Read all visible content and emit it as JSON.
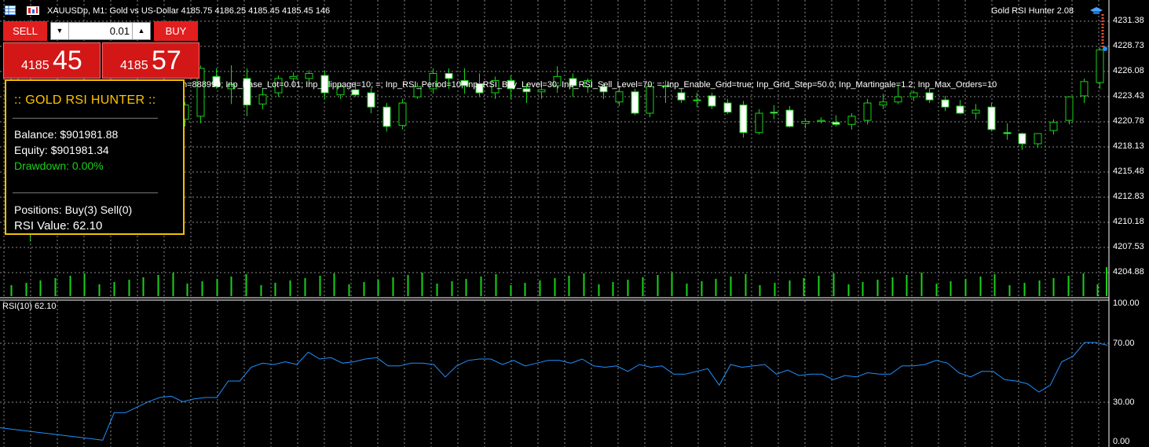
{
  "header": {
    "symbol_line": "XAUUSDp, M1:  Gold vs US-Dollar  4185.75 4186.25 4185.45 4185.45  146",
    "ea_name": "Gold RSI Hunter 2.08",
    "inputs_line": "n=888999; Inp_Base_Lot=0.01; Inp_Slippage=10; =; Inp_RSI_Period=10; Inp_RSI_Buy_Level=30; Inp_RSI_Sell_Level=70; =; Inp_Enable_Grid=true; Inp_Grid_Step=50.0; Inp_Martingale=1.2; Inp_Max_Orders=10"
  },
  "trade_panel": {
    "sell_label": "SELL",
    "buy_label": "BUY",
    "lot_value": "0.01",
    "sell_price_small": "4185",
    "sell_price_big": "45",
    "buy_price_small": "4185",
    "buy_price_big": "57"
  },
  "info_panel": {
    "title": ":: GOLD RSI HUNTER ::",
    "balance": "Balance:  $901981.88",
    "equity": "Equity:   $901981.34",
    "drawdown": "Drawdown: 0.00%",
    "positions": "Positions: Buy(3) Sell(0)",
    "rsi_value": "RSI Value: 62.10"
  },
  "price_axis": [
    "4231.38",
    "4228.73",
    "4226.08",
    "4223.43",
    "4220.78",
    "4218.13",
    "4215.48",
    "4212.83",
    "4210.18",
    "4207.53",
    "4204.88"
  ],
  "rsi_axis": [
    "100.00",
    "70.00",
    "30.00",
    "0.00"
  ],
  "rsi_label": "RSI(10) 62.10",
  "colors": {
    "background": "#000000",
    "grid": "#8a8a8a",
    "bull_candle": "#000000",
    "bear_candle": "#ffffff",
    "candle_outline": "#19d219",
    "volume": "#19d219",
    "rsi_line": "#1e90ff",
    "panel_border": "#f2c200",
    "sell_buy": "#e21f1f"
  },
  "chart_data": {
    "type": "candlestick",
    "price_range": [
      4203.5,
      4232.7
    ],
    "candles": [
      [
        4224.0,
        4226.3,
        4223.2,
        4225.6
      ],
      [
        4219.0,
        4221.3,
        4209.0,
        4219.0
      ],
      [
        4218.3,
        4220.0,
        4214.8,
        4215.4
      ],
      [
        4215.3,
        4216.3,
        4214.2,
        4214.9
      ],
      [
        4214.9,
        4216.0,
        4214.6,
        4215.5
      ],
      [
        4215.3,
        4215.8,
        4214.9,
        4215.5
      ],
      [
        4215.5,
        4217.5,
        4215.0,
        4217.2
      ],
      [
        4217.4,
        4220.8,
        4217.0,
        4220.6
      ],
      [
        4220.7,
        4222.2,
        4220.1,
        4222.0
      ],
      [
        4221.8,
        4222.5,
        4220.5,
        4221.6
      ],
      [
        4221.5,
        4222.3,
        4220.4,
        4222.0
      ],
      [
        4221.0,
        4222.7,
        4220.3,
        4222.4
      ],
      [
        4221.3,
        4226.3,
        4220.6,
        4226.0
      ],
      [
        4225.2,
        4226.0,
        4224.0,
        4224.2
      ],
      [
        4224.0,
        4226.3,
        4222.5,
        4224.4
      ],
      [
        4225.0,
        4226.0,
        4221.3,
        4222.4
      ],
      [
        4222.5,
        4224.0,
        4222.0,
        4223.4
      ],
      [
        4223.6,
        4225.3,
        4223.2,
        4225.0
      ],
      [
        4225.0,
        4225.6,
        4224.2,
        4225.2
      ],
      [
        4225.0,
        4225.8,
        4224.5,
        4225.5
      ],
      [
        4225.3,
        4225.8,
        4223.0,
        4223.6
      ],
      [
        4223.4,
        4224.5,
        4223.0,
        4224.2
      ],
      [
        4223.9,
        4224.7,
        4223.2,
        4223.4
      ],
      [
        4223.6,
        4224.0,
        4221.6,
        4222.2
      ],
      [
        4222.2,
        4222.6,
        4219.8,
        4220.3
      ],
      [
        4220.4,
        4223.0,
        4220.0,
        4222.6
      ],
      [
        4223.2,
        4224.6,
        4223.0,
        4224.2
      ],
      [
        4224.0,
        4226.0,
        4223.5,
        4225.5
      ],
      [
        4225.5,
        4226.0,
        4224.0,
        4225.0
      ],
      [
        4224.8,
        4226.0,
        4223.5,
        4224.3
      ],
      [
        4224.5,
        4225.5,
        4223.2,
        4223.6
      ],
      [
        4223.6,
        4225.2,
        4223.0,
        4224.8
      ],
      [
        4224.8,
        4225.3,
        4223.0,
        4224.0
      ],
      [
        4224.0,
        4224.5,
        4222.6,
        4223.7
      ],
      [
        4223.7,
        4224.6,
        4223.0,
        4223.9
      ],
      [
        4224.3,
        4226.2,
        4223.6,
        4225.2
      ],
      [
        4225.0,
        4225.5,
        4223.2,
        4224.3
      ],
      [
        4224.2,
        4225.0,
        4223.6,
        4224.8
      ],
      [
        4224.2,
        4224.6,
        4223.0,
        4223.7
      ],
      [
        4222.7,
        4224.3,
        4222.3,
        4223.7
      ],
      [
        4223.7,
        4224.0,
        4221.4,
        4221.6
      ],
      [
        4221.6,
        4224.5,
        4221.2,
        4224.2
      ],
      [
        4224.3,
        4224.8,
        4222.6,
        4224.2
      ],
      [
        4223.6,
        4224.0,
        4222.6,
        4222.9
      ],
      [
        4222.9,
        4223.6,
        4222.2,
        4222.9
      ],
      [
        4223.3,
        4223.6,
        4222.0,
        4222.3
      ],
      [
        4222.6,
        4223.0,
        4221.5,
        4221.7
      ],
      [
        4222.4,
        4222.8,
        4219.2,
        4219.7
      ],
      [
        4219.7,
        4222.0,
        4219.5,
        4221.6
      ],
      [
        4221.7,
        4222.4,
        4221.0,
        4221.6
      ],
      [
        4221.9,
        4222.3,
        4220.2,
        4220.3
      ],
      [
        4220.6,
        4221.0,
        4220.1,
        4220.8
      ],
      [
        4220.8,
        4221.2,
        4220.6,
        4220.9
      ],
      [
        4220.7,
        4221.4,
        4220.3,
        4220.5
      ],
      [
        4220.5,
        4221.6,
        4220.0,
        4221.3
      ],
      [
        4220.9,
        4223.0,
        4220.5,
        4222.6
      ],
      [
        4222.4,
        4223.5,
        4222.0,
        4222.7
      ],
      [
        4222.7,
        4224.4,
        4222.5,
        4223.2
      ],
      [
        4223.2,
        4223.8,
        4222.8,
        4223.6
      ],
      [
        4223.6,
        4224.0,
        4222.6,
        4222.9
      ],
      [
        4222.9,
        4223.3,
        4221.8,
        4222.2
      ],
      [
        4222.3,
        4222.9,
        4221.5,
        4221.6
      ],
      [
        4221.6,
        4222.5,
        4221.0,
        4221.9
      ],
      [
        4222.2,
        4222.6,
        4219.8,
        4220.0
      ],
      [
        4219.7,
        4220.6,
        4219.0,
        4219.6
      ],
      [
        4219.6,
        4219.7,
        4218.0,
        4218.6
      ],
      [
        4218.6,
        4219.6,
        4218.2,
        4219.6
      ],
      [
        4219.9,
        4221.0,
        4219.5,
        4220.7
      ],
      [
        4220.9,
        4223.2,
        4220.5,
        4223.2
      ],
      [
        4223.3,
        4225.0,
        4222.6,
        4224.7
      ],
      [
        4224.6,
        4228.0,
        4224.0,
        4227.8
      ]
    ],
    "rsi_values": [
      10,
      9,
      8,
      7,
      6,
      5,
      4,
      3,
      2,
      1,
      21,
      21,
      25,
      29,
      32,
      33,
      29,
      31,
      32,
      32,
      44,
      44,
      54,
      57,
      56,
      58,
      56,
      65,
      60,
      61,
      57,
      58,
      60,
      61,
      55,
      55,
      57,
      57,
      56,
      47,
      55,
      59,
      60,
      60,
      56,
      59,
      55,
      57,
      59,
      59,
      57,
      60,
      55,
      54,
      55,
      51,
      56,
      54,
      55,
      49,
      49,
      51,
      53,
      41,
      56,
      54,
      55,
      56,
      49,
      52,
      48,
      49,
      49,
      45,
      48,
      47,
      50,
      49,
      49,
      55,
      55,
      56,
      59,
      57,
      50,
      47,
      51,
      51,
      45,
      44,
      42,
      36,
      41,
      58,
      62,
      72,
      72,
      70
    ],
    "title": "",
    "xlabel": "",
    "ylabel": ""
  }
}
